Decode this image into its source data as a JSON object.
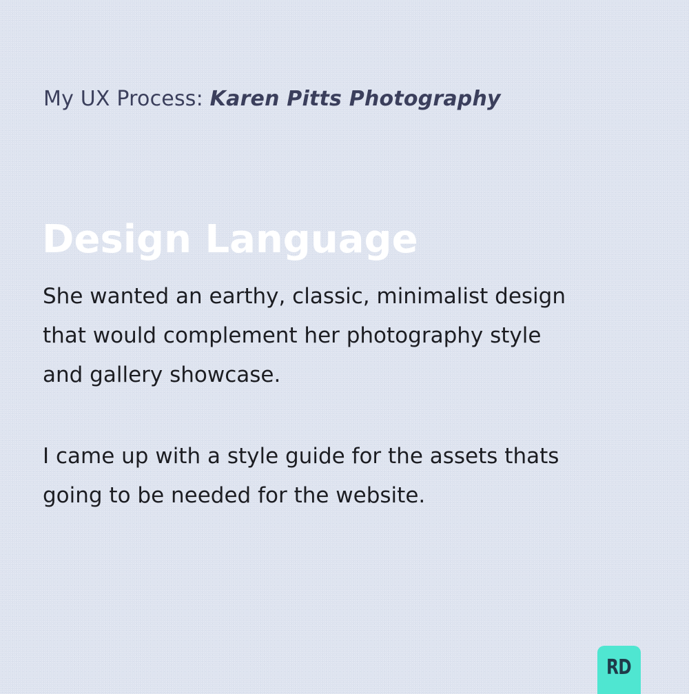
{
  "header": {
    "prefix": "My UX Process: ",
    "project": "Karen Pitts Photography"
  },
  "section": {
    "title": "Design Language",
    "paragraph_1": [
      "She wanted an earthy, classic, minimalist design",
      "that would complement her photography style",
      "and gallery showcase."
    ],
    "paragraph_2": [
      "I came up with a style guide for the assets thats",
      "going to be needed for the website."
    ]
  },
  "logo": {
    "text": "RD",
    "color": "#4fe6d1"
  },
  "colors": {
    "background": "#dde3ef",
    "heading": "#ffffff",
    "header_text": "#3b3f5c",
    "body_text": "#1c1d22"
  }
}
